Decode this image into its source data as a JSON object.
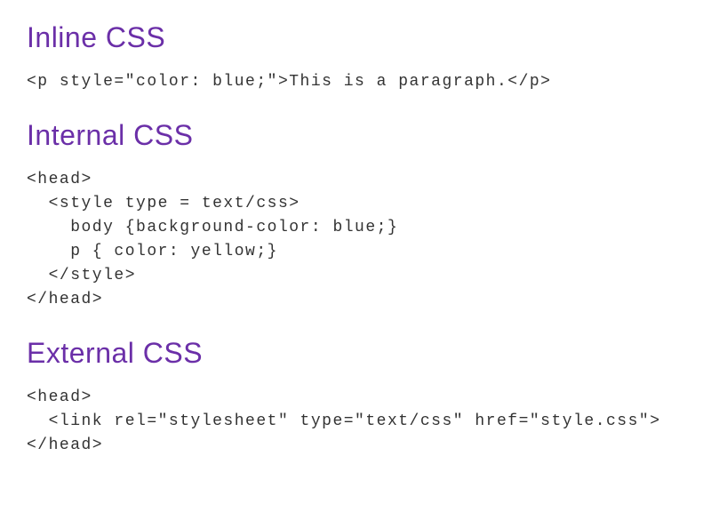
{
  "sections": [
    {
      "heading": "Inline CSS",
      "code": "<p style=\"color: blue;\">This is a paragraph.</p>"
    },
    {
      "heading": "Internal CSS",
      "code": "<head>\n  <style type = text/css>\n    body {background-color: blue;}\n    p { color: yellow;}\n  </style>\n</head>"
    },
    {
      "heading": "External CSS",
      "code": "<head>\n  <link rel=\"stylesheet\" type=\"text/css\" href=\"style.css\">\n</head>"
    }
  ]
}
